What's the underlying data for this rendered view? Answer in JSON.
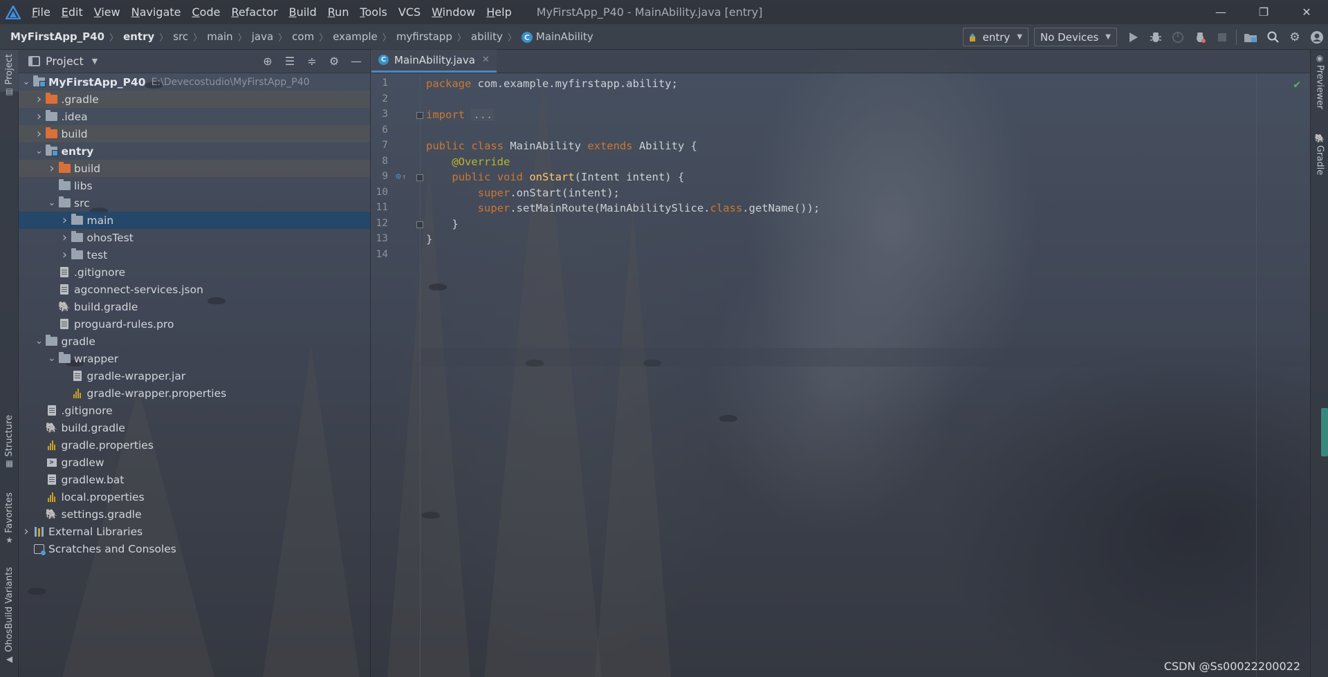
{
  "menubar": {
    "items": [
      {
        "label": "File",
        "mnemonic": "F",
        "rest": "ile"
      },
      {
        "label": "Edit",
        "mnemonic": "E",
        "rest": "dit"
      },
      {
        "label": "View",
        "mnemonic": "V",
        "rest": "iew"
      },
      {
        "label": "Navigate",
        "mnemonic": "N",
        "rest": "avigate"
      },
      {
        "label": "Code",
        "mnemonic": "C",
        "rest": "ode"
      },
      {
        "label": "Refactor",
        "mnemonic": "R",
        "rest": "efactor"
      },
      {
        "label": "Build",
        "mnemonic": "B",
        "rest": "uild"
      },
      {
        "label": "Run",
        "mnemonic": "R",
        "rest": "un"
      },
      {
        "label": "Tools",
        "mnemonic": "T",
        "rest": "ools"
      },
      {
        "label": "VCS",
        "mnemonic": "",
        "rest": "VCS"
      },
      {
        "label": "Window",
        "mnemonic": "W",
        "rest": "indow"
      },
      {
        "label": "Help",
        "mnemonic": "H",
        "rest": "elp"
      }
    ],
    "window_title": "MyFirstApp_P40 - MainAbility.java [entry]",
    "controls": {
      "minimize": "—",
      "restore": "❐",
      "close": "✕"
    }
  },
  "navbar": {
    "breadcrumbs": [
      "MyFirstApp_P40",
      "entry",
      "src",
      "main",
      "java",
      "com",
      "example",
      "myfirstapp",
      "ability",
      "MainAbility"
    ],
    "separator": "〉",
    "run_config": "entry",
    "device": "No Devices",
    "caret": "▼"
  },
  "left_strip": {
    "project": "Project",
    "structure": "Structure",
    "favorites": "Favorites",
    "ohos_build": "OhosBuild Variants"
  },
  "right_strip": {
    "previewer": "Previewer",
    "gradle": "Gradle"
  },
  "project_panel": {
    "title": "Project",
    "tree": [
      {
        "label": "MyFirstApp_P40",
        "path": "E:\\Devecostudio\\MyFirstApp_P40",
        "depth": 0,
        "arrow": "expanded",
        "icon": "module-folder",
        "bold": true
      },
      {
        "label": ".gradle",
        "depth": 1,
        "arrow": "collapsed",
        "icon": "orange-folder",
        "excluded": true
      },
      {
        "label": ".idea",
        "depth": 1,
        "arrow": "collapsed",
        "icon": "folder"
      },
      {
        "label": "build",
        "depth": 1,
        "arrow": "collapsed",
        "icon": "orange-folder",
        "excluded": true
      },
      {
        "label": "entry",
        "depth": 1,
        "arrow": "expanded",
        "icon": "module-folder",
        "bold": true
      },
      {
        "label": "build",
        "depth": 2,
        "arrow": "collapsed",
        "icon": "orange-folder",
        "excluded": true
      },
      {
        "label": "libs",
        "depth": 2,
        "arrow": "none",
        "icon": "folder"
      },
      {
        "label": "src",
        "depth": 2,
        "arrow": "expanded",
        "icon": "folder"
      },
      {
        "label": "main",
        "depth": 3,
        "arrow": "collapsed",
        "icon": "folder",
        "selected": true
      },
      {
        "label": "ohosTest",
        "depth": 3,
        "arrow": "collapsed",
        "icon": "folder"
      },
      {
        "label": "test",
        "depth": 3,
        "arrow": "collapsed",
        "icon": "folder"
      },
      {
        "label": ".gitignore",
        "depth": 2,
        "arrow": "none",
        "icon": "file"
      },
      {
        "label": "agconnect-services.json",
        "depth": 2,
        "arrow": "none",
        "icon": "file"
      },
      {
        "label": "build.gradle",
        "depth": 2,
        "arrow": "none",
        "icon": "gradle"
      },
      {
        "label": "proguard-rules.pro",
        "depth": 2,
        "arrow": "none",
        "icon": "file"
      },
      {
        "label": "gradle",
        "depth": 1,
        "arrow": "expanded",
        "icon": "folder"
      },
      {
        "label": "wrapper",
        "depth": 2,
        "arrow": "expanded",
        "icon": "folder"
      },
      {
        "label": "gradle-wrapper.jar",
        "depth": 3,
        "arrow": "none",
        "icon": "file"
      },
      {
        "label": "gradle-wrapper.properties",
        "depth": 3,
        "arrow": "none",
        "icon": "bars"
      },
      {
        "label": ".gitignore",
        "depth": 1,
        "arrow": "none",
        "icon": "file"
      },
      {
        "label": "build.gradle",
        "depth": 1,
        "arrow": "none",
        "icon": "gradle"
      },
      {
        "label": "gradle.properties",
        "depth": 1,
        "arrow": "none",
        "icon": "bars"
      },
      {
        "label": "gradlew",
        "depth": 1,
        "arrow": "none",
        "icon": "terminal"
      },
      {
        "label": "gradlew.bat",
        "depth": 1,
        "arrow": "none",
        "icon": "file"
      },
      {
        "label": "local.properties",
        "depth": 1,
        "arrow": "none",
        "icon": "bars"
      },
      {
        "label": "settings.gradle",
        "depth": 1,
        "arrow": "none",
        "icon": "gradle"
      },
      {
        "label": "External Libraries",
        "depth": 0,
        "arrow": "collapsed",
        "icon": "ext-lib"
      },
      {
        "label": "Scratches and Consoles",
        "depth": 0,
        "arrow": "none",
        "icon": "scratch"
      }
    ]
  },
  "editor": {
    "tab": {
      "label": "MainAbility.java",
      "icon": "class-c-icon",
      "close": "✕"
    },
    "lines": [
      {
        "n": "1",
        "parts": [
          [
            "kw",
            "package"
          ],
          [
            "t",
            " com.example.myfirstapp.ability;"
          ]
        ]
      },
      {
        "n": "2",
        "parts": []
      },
      {
        "n": "3",
        "parts": [
          [
            "kw",
            "import"
          ],
          [
            "t",
            " "
          ],
          [
            "fold",
            "..."
          ]
        ]
      },
      {
        "n": "6",
        "parts": []
      },
      {
        "n": "7",
        "parts": [
          [
            "kw",
            "public class"
          ],
          [
            "t",
            " MainAbility "
          ],
          [
            "kw",
            "extends"
          ],
          [
            "t",
            " Ability {"
          ]
        ]
      },
      {
        "n": "8",
        "parts": [
          [
            "t",
            "    "
          ],
          [
            "ann",
            "@Override"
          ]
        ]
      },
      {
        "n": "9",
        "parts": [
          [
            "t",
            "    "
          ],
          [
            "kw",
            "public void"
          ],
          [
            "t",
            " "
          ],
          [
            "fn",
            "onStart"
          ],
          [
            "t",
            "(Intent intent) {"
          ]
        ]
      },
      {
        "n": "10",
        "parts": [
          [
            "t",
            "        "
          ],
          [
            "kw",
            "super"
          ],
          [
            "t",
            ".onStart(intent);"
          ]
        ]
      },
      {
        "n": "11",
        "parts": [
          [
            "t",
            "        "
          ],
          [
            "kw",
            "super"
          ],
          [
            "t",
            ".setMainRoute(MainAbilitySlice."
          ],
          [
            "kw",
            "class"
          ],
          [
            "t",
            ".getName());"
          ]
        ]
      },
      {
        "n": "12",
        "parts": [
          [
            "t",
            "    }"
          ]
        ]
      },
      {
        "n": "13",
        "parts": [
          [
            "t",
            "}"
          ]
        ]
      },
      {
        "n": "14",
        "parts": []
      }
    ],
    "fold_marker": "⊟",
    "override_marker": "⊙",
    "override_up": "↑",
    "inspection_ok": "✔"
  },
  "watermark": "CSDN @Ss00022200022",
  "colors": {
    "keyword": "#cc7832",
    "annotation": "#bbb529",
    "function": "#ffc66d",
    "selection": "#20466c",
    "accent": "#4a88c7"
  }
}
